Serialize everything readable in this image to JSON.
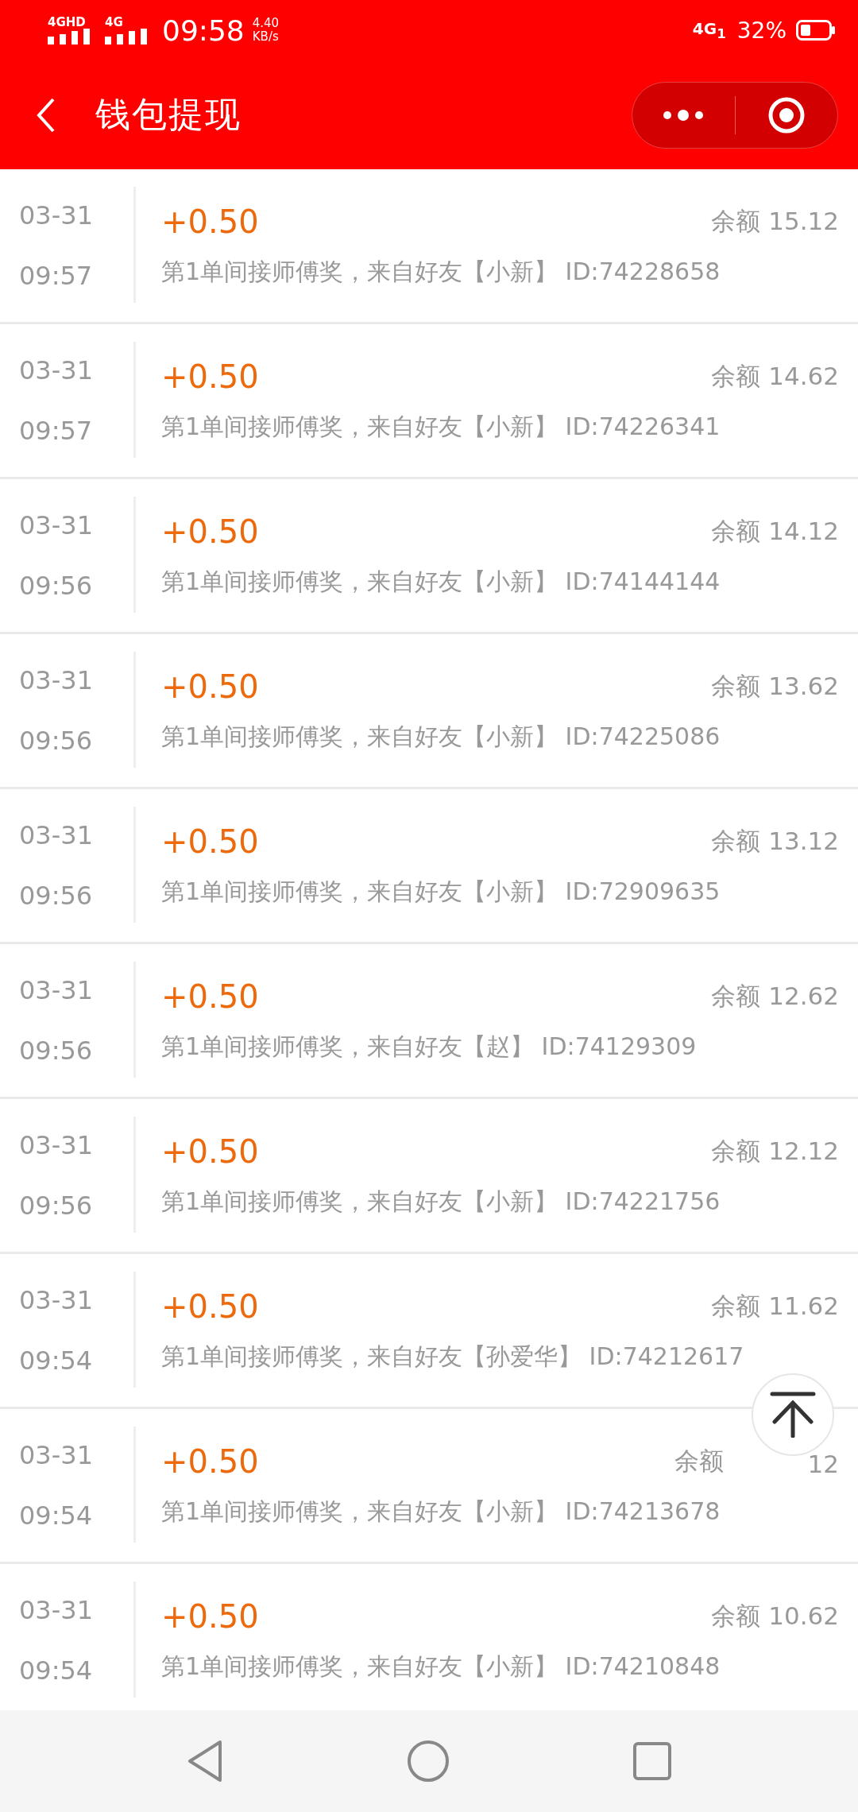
{
  "status_bar": {
    "network_1": "4GHD",
    "network_2": "4G",
    "time": "09:58",
    "speed": "4.40",
    "speed_unit": "KB/s",
    "network_3": "4G$_{1}$",
    "battery": "32%"
  },
  "title_bar": {
    "title": "钱包提现"
  },
  "records": [
    {
      "date": "03-31",
      "time": "09:57",
      "amount": "+0.50",
      "balance": "余额 15.12",
      "description": "第1单间接师傅奖，来自好友【小新】 ID:74228658"
    },
    {
      "date": "03-31",
      "time": "09:57",
      "amount": "+0.50",
      "balance": "余额 14.62",
      "description": "第1单间接师傅奖，来自好友【小新】 ID:74226341"
    },
    {
      "date": "03-31",
      "time": "09:56",
      "amount": "+0.50",
      "balance": "余额 14.12",
      "description": "第1单间接师傅奖，来自好友【小新】 ID:74144144"
    },
    {
      "date": "03-31",
      "time": "09:56",
      "amount": "+0.50",
      "balance": "余额 13.62",
      "description": "第1单间接师傅奖，来自好友【小新】 ID:74225086"
    },
    {
      "date": "03-31",
      "time": "09:56",
      "amount": "+0.50",
      "balance": "余额 13.12",
      "description": "第1单间接师傅奖，来自好友【小新】 ID:72909635"
    },
    {
      "date": "03-31",
      "time": "09:56",
      "amount": "+0.50",
      "balance": "余额 12.62",
      "description": "第1单间接师傅奖，来自好友【赵】 ID:74129309"
    },
    {
      "date": "03-31",
      "time": "09:56",
      "amount": "+0.50",
      "balance": "余额 12.12",
      "description": "第1单间接师傅奖，来自好友【小新】 ID:74221756"
    },
    {
      "date": "03-31",
      "time": "09:54",
      "amount": "+0.50",
      "balance": "余额 11.62",
      "description": "第1单间接师傅奖，来自好友【孙爱华】 ID:74212617"
    },
    {
      "date": "03-31",
      "time": "09:54",
      "amount": "+0.50",
      "balance": "余额",
      "balance_tail": "12",
      "description": "第1单间接师傅奖，来自好友【小新】 ID:74213678"
    },
    {
      "date": "03-31",
      "time": "09:54",
      "amount": "+0.50",
      "balance": "余额 10.62",
      "description": "第1单间接师傅奖，来自好友【小新】 ID:74210848"
    }
  ]
}
